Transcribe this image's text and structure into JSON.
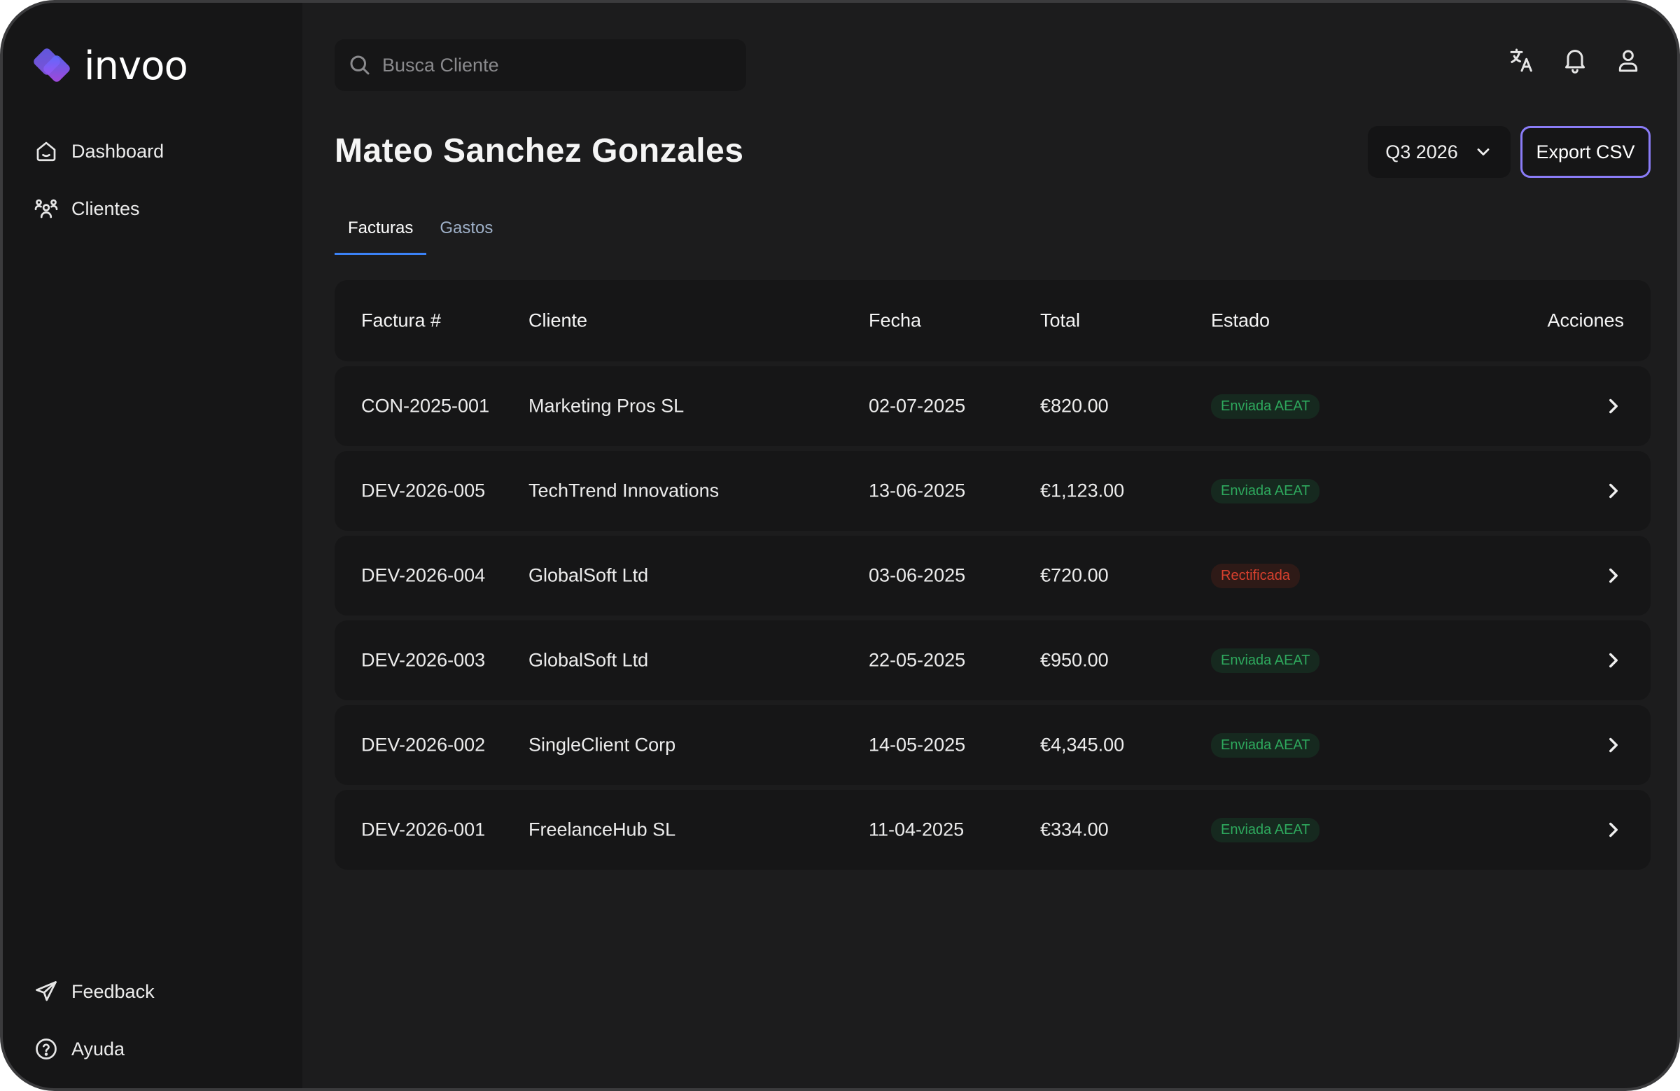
{
  "app": {
    "brand": "invoo"
  },
  "sidebar": {
    "items": [
      {
        "label": "Dashboard",
        "icon": "home-icon"
      },
      {
        "label": "Clientes",
        "icon": "users-icon"
      }
    ],
    "bottom_items": [
      {
        "label": "Feedback",
        "icon": "send-icon"
      },
      {
        "label": "Ayuda",
        "icon": "help-icon"
      }
    ]
  },
  "search": {
    "placeholder": "Busca Cliente"
  },
  "header": {
    "title": "Mateo Sanchez Gonzales",
    "period": "Q3 2026",
    "export_label": "Export CSV"
  },
  "tabs": [
    {
      "label": "Facturas",
      "active": true
    },
    {
      "label": "Gastos",
      "active": false
    }
  ],
  "table": {
    "columns": [
      "Factura #",
      "Cliente",
      "Fecha",
      "Total",
      "Estado",
      "Acciones"
    ],
    "rows": [
      {
        "factura": "CON-2025-001",
        "cliente": "Marketing Pros SL",
        "fecha": "02-07-2025",
        "total": "€820.00",
        "estado": "Enviada AEAT"
      },
      {
        "factura": "DEV-2026-005",
        "cliente": "TechTrend Innovations",
        "fecha": "13-06-2025",
        "total": "€1,123.00",
        "estado": "Enviada AEAT"
      },
      {
        "factura": "DEV-2026-004",
        "cliente": "GlobalSoft Ltd",
        "fecha": "03-06-2025",
        "total": "€720.00",
        "estado": "Rectificada"
      },
      {
        "factura": "DEV-2026-003",
        "cliente": "GlobalSoft Ltd",
        "fecha": "22-05-2025",
        "total": "€950.00",
        "estado": "Enviada AEAT"
      },
      {
        "factura": "DEV-2026-002",
        "cliente": "SingleClient Corp",
        "fecha": "14-05-2025",
        "total": "€4,345.00",
        "estado": "Enviada AEAT"
      },
      {
        "factura": "DEV-2026-001",
        "cliente": "FreelanceHub SL",
        "fecha": "11-04-2025",
        "total": "€334.00",
        "estado": "Enviada AEAT"
      }
    ]
  },
  "colors": {
    "background": "#1c1c1d",
    "sidebar": "#161617",
    "accent_tab": "#3b82f6",
    "export_border": "#8a7cf7",
    "status_ok": "#2ea85d",
    "status_bad": "#d8402e"
  }
}
